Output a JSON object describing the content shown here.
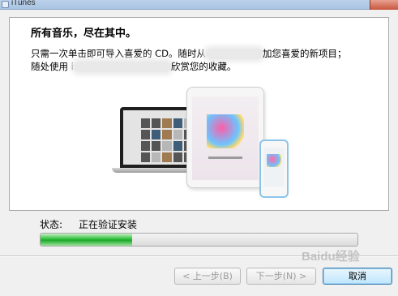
{
  "window": {
    "title": "iTunes"
  },
  "content": {
    "heading": "所有音乐，尽在其中。",
    "line1_part1": "只需一次单击即可导入喜爱的 CD。随时从",
    "line1_part2": "加您喜爱的新项目；",
    "line2_part1": "随处使用 i",
    "line2_part2": "欣赏您的收藏。"
  },
  "status": {
    "label": "状态:",
    "value": "正在验证安装",
    "progress_fraction": 0.29
  },
  "buttons": {
    "back": "< 上一步(B)",
    "next": "下一步(N) >",
    "cancel": "取消"
  },
  "watermark": "Baidu经验"
}
